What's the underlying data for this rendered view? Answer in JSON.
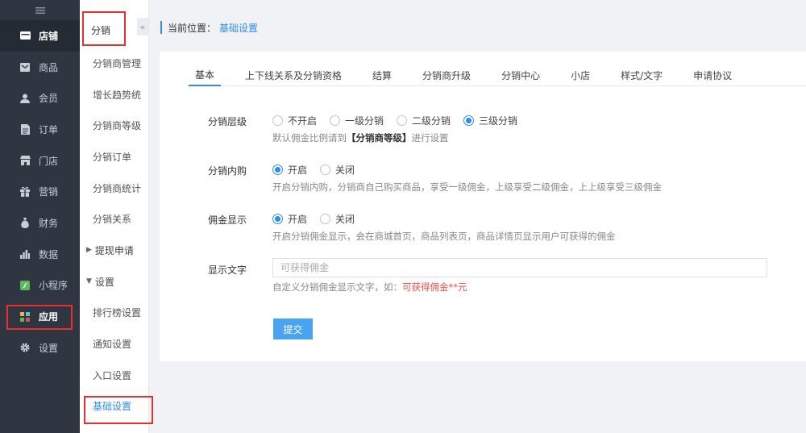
{
  "sidebar": {
    "toggle_icon": "collapse-icon",
    "items": [
      {
        "label": "店铺",
        "icon": "store-icon"
      },
      {
        "label": "商品",
        "icon": "goods-icon"
      },
      {
        "label": "会员",
        "icon": "user-icon"
      },
      {
        "label": "订单",
        "icon": "order-icon"
      },
      {
        "label": "门店",
        "icon": "shop-icon"
      },
      {
        "label": "营销",
        "icon": "gift-icon"
      },
      {
        "label": "财务",
        "icon": "money-bag-icon"
      },
      {
        "label": "数据",
        "icon": "bar-chart-icon"
      },
      {
        "label": "小程序",
        "icon": "mini-program-icon"
      },
      {
        "label": "应用",
        "icon": "apps-icon"
      },
      {
        "label": "设置",
        "icon": "gear-icon"
      }
    ]
  },
  "submenu": {
    "title": "分销",
    "items": [
      "分销商管理",
      "增长趋势统",
      "分销商等级",
      "分销订单",
      "分销商统计",
      "分销关系"
    ],
    "group_collapsed": "提现申请",
    "group_expanded": "设置",
    "settings_items": [
      "排行榜设置",
      "通知设置",
      "入口设置",
      "基础设置"
    ]
  },
  "breadcrumb": {
    "prefix": "当前位置：",
    "current": "基础设置"
  },
  "tabs": [
    "基本",
    "上下线关系及分销资格",
    "结算",
    "分销商升级",
    "分销中心",
    "小店",
    "样式/文字",
    "申请协议"
  ],
  "form": {
    "level": {
      "label": "分销层级",
      "options": [
        "不开启",
        "一级分销",
        "二级分销",
        "三级分销"
      ],
      "selected": "三级分销",
      "hint_pre": "默认佣金比例请到",
      "hint_bold": "【分销商等级】",
      "hint_post": "进行设置"
    },
    "inner_buy": {
      "label": "分销内购",
      "options": [
        "开启",
        "关闭"
      ],
      "selected": "开启",
      "hint": "开启分销内购，分销商自己购买商品，享受一级佣金，上级享受二级佣金，上上级享受三级佣金"
    },
    "commission_display": {
      "label": "佣金显示",
      "options": [
        "开启",
        "关闭"
      ],
      "selected": "开启",
      "hint": "开启分销佣金显示，会在商城首页，商品列表页，商品详情页显示用户可获得的佣金"
    },
    "display_text": {
      "label": "显示文字",
      "value": "",
      "placeholder": "可获得佣金",
      "hint_pre": "自定义分销佣金显示文字，如：",
      "hint_red": "可获得佣金**元"
    },
    "submit_label": "提交"
  },
  "colors": {
    "accent": "#2d8cf0",
    "sidebar_bg": "#2f3642",
    "highlight_frame": "#e8302f",
    "hint_red": "#ea4a4a"
  }
}
